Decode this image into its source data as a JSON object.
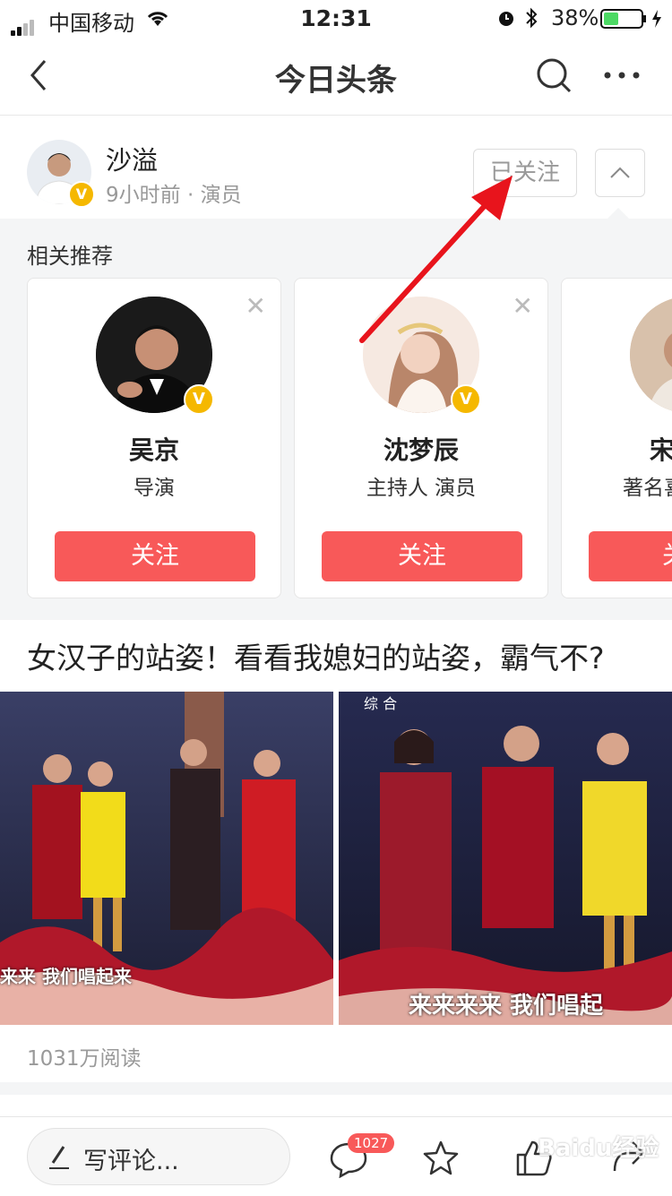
{
  "status_bar": {
    "carrier": "中国移动",
    "time": "12:31",
    "battery": "38%"
  },
  "nav": {
    "title": "今日头条"
  },
  "author": {
    "name": "沙溢",
    "meta": "9小时前 · 演员",
    "follow_state": "已关注"
  },
  "recommend": {
    "title": "相关推荐",
    "cards": [
      {
        "name": "吴京",
        "role": "导演",
        "button": "关注"
      },
      {
        "name": "沈梦辰",
        "role": "主持人 演员",
        "button": "关注"
      },
      {
        "name": "宋",
        "role": "著名喜",
        "button": "关"
      }
    ]
  },
  "article": {
    "headline": "女汉子的站姿！看看我媳妇的站姿，霸气不?",
    "caption_left": "来来 我们唱起来",
    "caption_right": "来来来来 我们唱起",
    "tv_logo": "综 合",
    "reads": "1031万阅读"
  },
  "bottom_bar": {
    "comment_placeholder": "写评论...",
    "comment_count": "1027",
    "watermark": "Baidu经验"
  },
  "colors": {
    "accent": "#f85959",
    "badge": "#f5b800",
    "arrow": "#e8141c"
  }
}
